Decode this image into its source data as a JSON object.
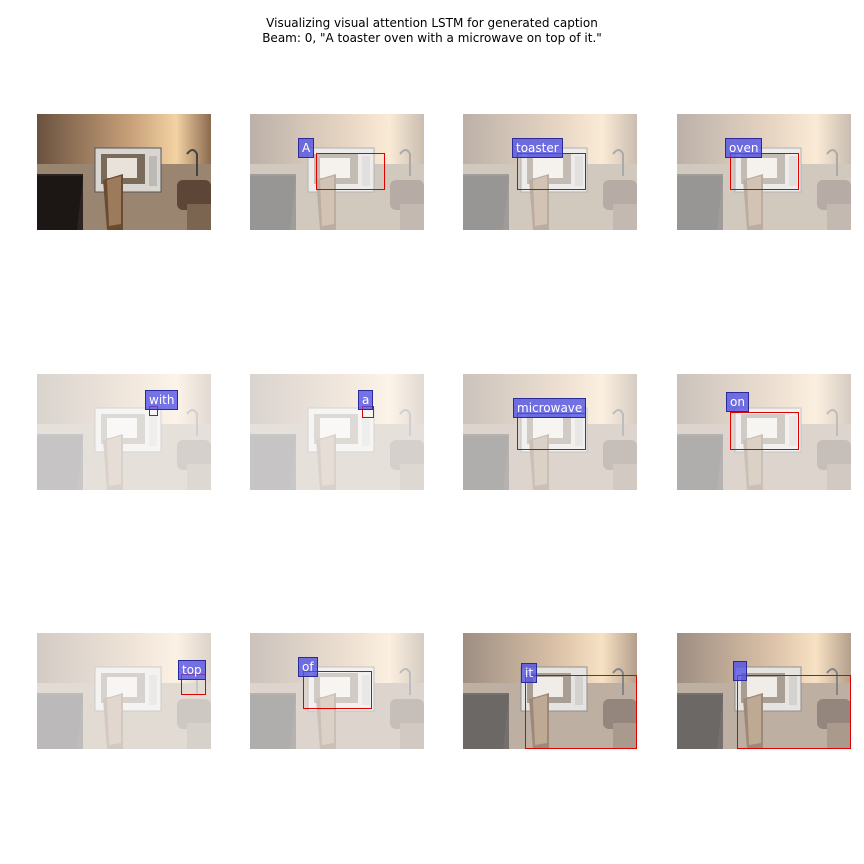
{
  "title": {
    "line1": "Visualizing visual attention LSTM for generated caption",
    "line2": "Beam: 0, \"A toaster oven with a microwave on top of it.\""
  },
  "panels": [
    {
      "word": ""
    },
    {
      "word": "A"
    },
    {
      "word": "toaster"
    },
    {
      "word": "oven"
    },
    {
      "word": "with"
    },
    {
      "word": "a"
    },
    {
      "word": "microwave"
    },
    {
      "word": "on"
    },
    {
      "word": "top"
    },
    {
      "word": "of"
    },
    {
      "word": "it"
    },
    {
      "word": ""
    }
  ],
  "colors": {
    "box": "#e00000",
    "label_bg": "#5050e6",
    "label_text": "#ffffff"
  }
}
